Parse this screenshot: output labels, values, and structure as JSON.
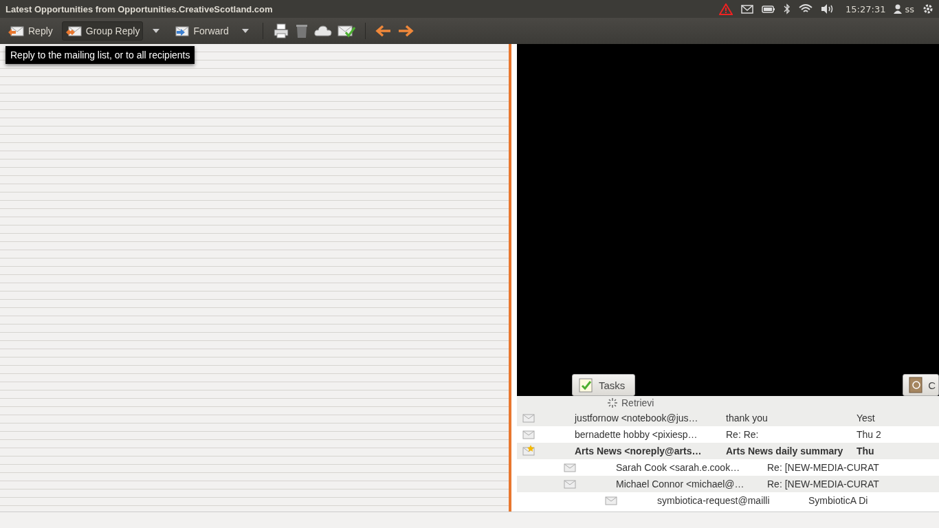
{
  "window": {
    "title": "Latest Opportunities from Opportunities.CreativeScotland.com"
  },
  "panel": {
    "clock": "15:27:31",
    "user": "ss"
  },
  "toolbar": {
    "buttons": [
      {
        "label": "Reply",
        "kind": "reply",
        "selected": false,
        "dropdown": false
      },
      {
        "label": "Group Reply",
        "kind": "group",
        "selected": true,
        "dropdown": true
      },
      {
        "label": "Forward",
        "kind": "forward",
        "selected": false,
        "dropdown": true
      }
    ]
  },
  "tooltip": "Reply to the mailing list, or to all recipients",
  "tasks_button": "Tasks",
  "contacts_button": "C",
  "status": "Retrievi",
  "messages": [
    {
      "sender": "justfornow <notebook@jus…",
      "subject": "thank you",
      "date": "Yest",
      "bold": false,
      "starred": false
    },
    {
      "sender": "bernadette hobby <pixiesp…",
      "subject": "Re: Re:",
      "date": "Thu 2",
      "bold": false,
      "starred": false
    },
    {
      "sender": "Arts News <noreply@arts…",
      "subject": "Arts News daily summary",
      "date": "Thu",
      "bold": true,
      "starred": true,
      "children": [
        {
          "sender": "Sarah Cook <sarah.e.cook…",
          "subject": "Re: [NEW-MEDIA-CURAT",
          "bold": false,
          "starred": false
        },
        {
          "sender": "Michael Connor <michael@…",
          "subject": "Re: [NEW-MEDIA-CURAT",
          "bold": false,
          "starred": false,
          "children": [
            {
              "sender": "symbiotica-request@mailli",
              "subject": "SymbioticA Di",
              "bold": false,
              "starred": false
            }
          ]
        }
      ]
    }
  ]
}
